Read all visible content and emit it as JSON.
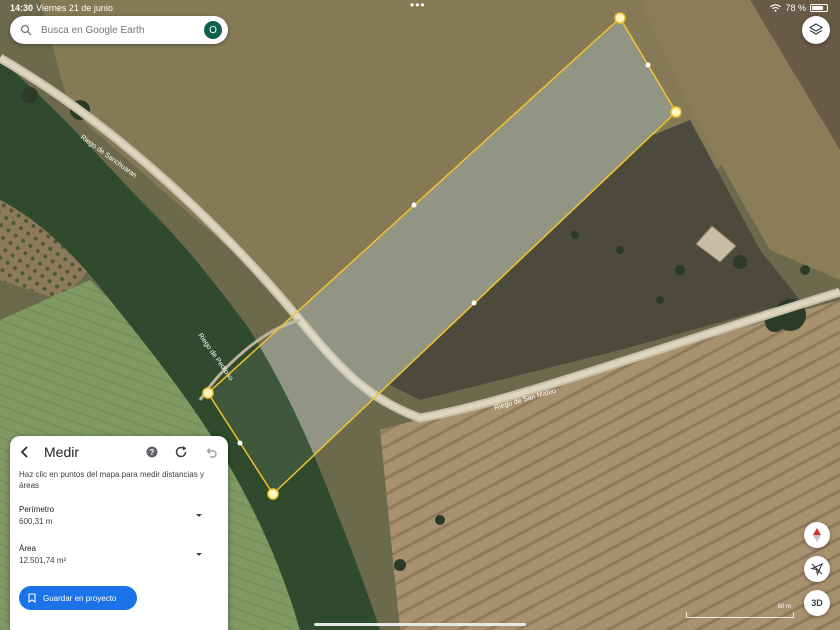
{
  "status_bar": {
    "time": "14:30",
    "date": "Viernes 21 de junio",
    "battery": "78 %",
    "battery_level": 0.78
  },
  "search": {
    "placeholder": "Busca en Google Earth",
    "avatar_initial": "O"
  },
  "map": {
    "road_labels": [
      "Riego de Sanchuaran",
      "Riego de Pedroso",
      "Riego de San Mateo"
    ]
  },
  "measure_panel": {
    "title": "Medir",
    "instructions": "Haz clic en puntos del mapa para medir distancias y áreas",
    "perimeter_label": "Perímetro",
    "perimeter_value": "600,31 m",
    "area_label": "Área",
    "area_value": "12.501,74 m²",
    "save_label": "Guardar en proyecto"
  },
  "controls": {
    "button_3d": "3D",
    "scale_label": "50 m"
  },
  "colors": {
    "measure_line": "#f2c230",
    "save_button": "#1a73e8",
    "avatar": "#0d5f4f"
  }
}
